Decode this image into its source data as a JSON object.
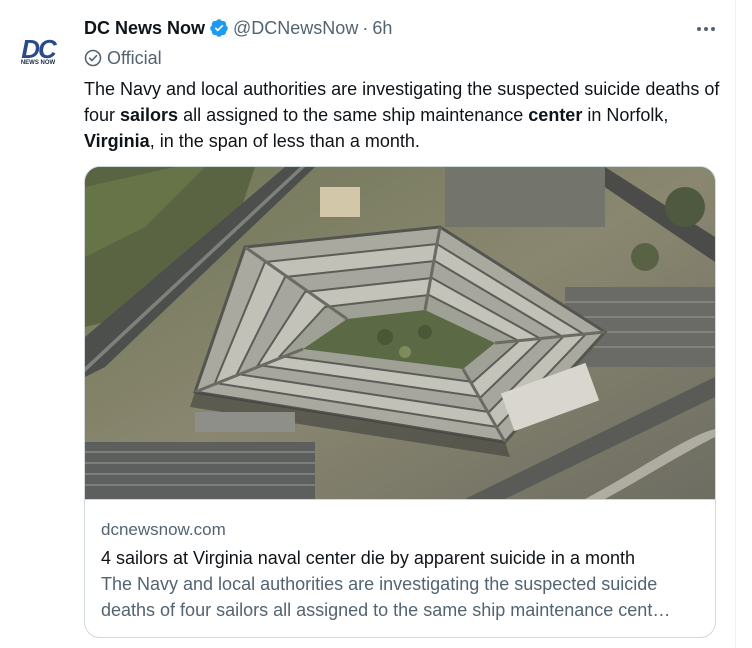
{
  "tweet": {
    "author_name": "DC News Now",
    "handle": "@DCNewsNow",
    "separator": "·",
    "time": "6h",
    "official_label": "Official",
    "avatar": {
      "logo_text": "DC",
      "logo_subtext": "NEWS NOW"
    },
    "text_segments": {
      "s1": "The Navy and local authorities are investigating the suspected suicide deaths of four ",
      "b1": "sailors",
      "s2": " all assigned to the same ship maintenance ",
      "b2": "center",
      "s3": " in Norfolk, ",
      "b3": "Virginia",
      "s4": ", in the span of less than a month."
    },
    "card": {
      "domain": "dcnewsnow.com",
      "title": "4 sailors at Virginia naval center die by apparent suicide in a month",
      "description_line1": "The Navy and local authorities are investigating the suspected suicide",
      "description_line2": "deaths of four sailors all assigned to the same ship maintenance cent…"
    }
  },
  "icons": {
    "verified": "verified-badge-icon",
    "official": "check-circle-icon",
    "more": "more-dots-icon"
  },
  "colors": {
    "verified_blue": "#1d9bf0",
    "secondary_text": "#536471",
    "primary_text": "#0f1419",
    "border": "#cfd9de",
    "logo_blue": "#2a4a8c"
  }
}
